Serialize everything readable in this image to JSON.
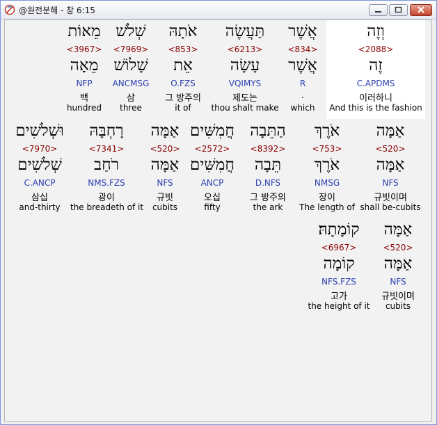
{
  "window": {
    "title": "@원전분해 - 창 6:15",
    "buttons": {
      "minimize": "minimize",
      "maximize": "maximize",
      "close": "close"
    }
  },
  "rows": [
    {
      "words": [
        {
          "hebrew": "וְזֶה",
          "strong": "<2088>",
          "lemma": "זֶה",
          "morph": "C.APDMS",
          "korean": "이러하니",
          "english": "And this is the fashion",
          "highlight": true
        },
        {
          "hebrew": "אֲשֶׁר",
          "strong": "<834>",
          "lemma": "אֲשֶׁר",
          "morph": "R",
          "korean": ".",
          "english": "which"
        },
        {
          "hebrew": "תַּעֲשֶׂה",
          "strong": "<6213>",
          "lemma": "עָשָׂה",
          "morph": "VQIMYS",
          "korean": "제도는",
          "english": "thou shalt make"
        },
        {
          "hebrew": "אֹתָהּ",
          "strong": "<853>",
          "lemma": "אֵת",
          "morph": "O.FZS",
          "korean": "그 방주의",
          "english": "it of"
        },
        {
          "hebrew": "שְׁלֹשׁ",
          "strong": "<7969>",
          "lemma": "שָׁלוֹשׁ",
          "morph": "ANCMSG",
          "korean": "삼",
          "english": "three"
        },
        {
          "hebrew": "מֵאוֹת",
          "strong": "<3967>",
          "lemma": "מֵאָה",
          "morph": "NFP",
          "korean": "백",
          "english": "hundred"
        }
      ]
    },
    {
      "words": [
        {
          "hebrew": "אַמָּה",
          "strong": "<520>",
          "lemma": "אַמָּה",
          "morph": "NFS",
          "korean": "규빗이며",
          "english": "shall be-cubits"
        },
        {
          "hebrew": "אֹרֶךְ",
          "strong": "<753>",
          "lemma": "אֹרֶךְ",
          "morph": "NMSG",
          "korean": "장이",
          "english": "The length of"
        },
        {
          "hebrew": "הַתֵּבָה",
          "strong": "<8392>",
          "lemma": "תֵּבָה",
          "morph": "D.NFS",
          "korean": "그 방주의",
          "english": "the ark"
        },
        {
          "hebrew": "חֲמִשִּׁים",
          "strong": "<2572>",
          "lemma": "חֲמִשִּׁים",
          "morph": "ANCP",
          "korean": "오십",
          "english": "fifty"
        },
        {
          "hebrew": "אַמָּה",
          "strong": "<520>",
          "lemma": "אַמָּה",
          "morph": "NFS",
          "korean": "규빗",
          "english": "cubits"
        },
        {
          "hebrew": "רָחְבָּהּ",
          "strong": "<7341>",
          "lemma": "רֹחַב",
          "morph": "NMS.FZS",
          "korean": "광이",
          "english": "the breadeth of it"
        },
        {
          "hebrew": "וּשְׁלֹשִׁים",
          "strong": "<7970>",
          "lemma": "שְׁלֹשִׁים",
          "morph": "C.ANCP",
          "korean": "삼십",
          "english": "and-thirty"
        }
      ]
    },
    {
      "words": [
        {
          "hebrew": "אַמָּה",
          "strong": "<520>",
          "lemma": "אַמָּה",
          "morph": "NFS",
          "korean": "규빗이며",
          "english": "cubits"
        },
        {
          "hebrew": "קוֹמָתָהּ׃",
          "strong": "<6967>",
          "lemma": "קוֹמָה",
          "morph": "NFS.FZS",
          "korean": "고가",
          "english": "the height of it"
        }
      ]
    }
  ]
}
